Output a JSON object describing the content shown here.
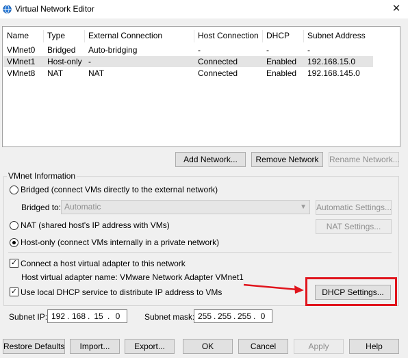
{
  "window": {
    "title": "Virtual Network Editor",
    "close_glyph": "✕",
    "icon": "globe-icon"
  },
  "table": {
    "columns": [
      "Name",
      "Type",
      "External Connection",
      "Host Connection",
      "DHCP",
      "Subnet Address"
    ],
    "rows": [
      [
        "VMnet0",
        "Bridged",
        "Auto-bridging",
        "-",
        "-",
        "-"
      ],
      [
        "VMnet1",
        "Host-only",
        "-",
        "Connected",
        "Enabled",
        "192.168.15.0"
      ],
      [
        "VMnet8",
        "NAT",
        "NAT",
        "Connected",
        "Enabled",
        "192.168.145.0"
      ]
    ],
    "selected_row": "VMnet1"
  },
  "network_buttons": {
    "add": "Add Network...",
    "remove": "Remove Network",
    "rename": "Rename Network..."
  },
  "vmnet_info": {
    "label": "VMnet Information",
    "bridged_label": "Bridged (connect VMs directly to the external network)",
    "bridged_to_label": "Bridged to:",
    "bridged_to_value": "Automatic",
    "auto_settings": "Automatic Settings...",
    "nat_label": "NAT (shared host's IP address with VMs)",
    "nat_settings": "NAT Settings...",
    "hostonly_label": "Host-only (connect VMs internally in a private network)",
    "connect_adapter_label": "Connect a host virtual adapter to this network",
    "adapter_name_text": "Host virtual adapter name: VMware Network Adapter VMnet1",
    "dhcp_label": "Use local DHCP service to distribute IP address to VMs",
    "dhcp_settings": "DHCP Settings...",
    "selected_mode": "Host-only",
    "connect_adapter_checked": true,
    "dhcp_checked": true,
    "check_glyph": "✓"
  },
  "subnet": {
    "ip_label": "Subnet IP:",
    "ip": [
      "192",
      "168",
      "15",
      "0"
    ],
    "mask_label": "Subnet mask:",
    "mask": [
      "255",
      "255",
      "255",
      "0"
    ]
  },
  "footer": {
    "restore": "Restore Defaults",
    "import": "Import...",
    "export": "Export...",
    "ok": "OK",
    "cancel": "Cancel",
    "apply": "Apply",
    "help": "Help"
  },
  "colors": {
    "highlight": "#e0141c",
    "selected_row": "#e4e4e4"
  }
}
